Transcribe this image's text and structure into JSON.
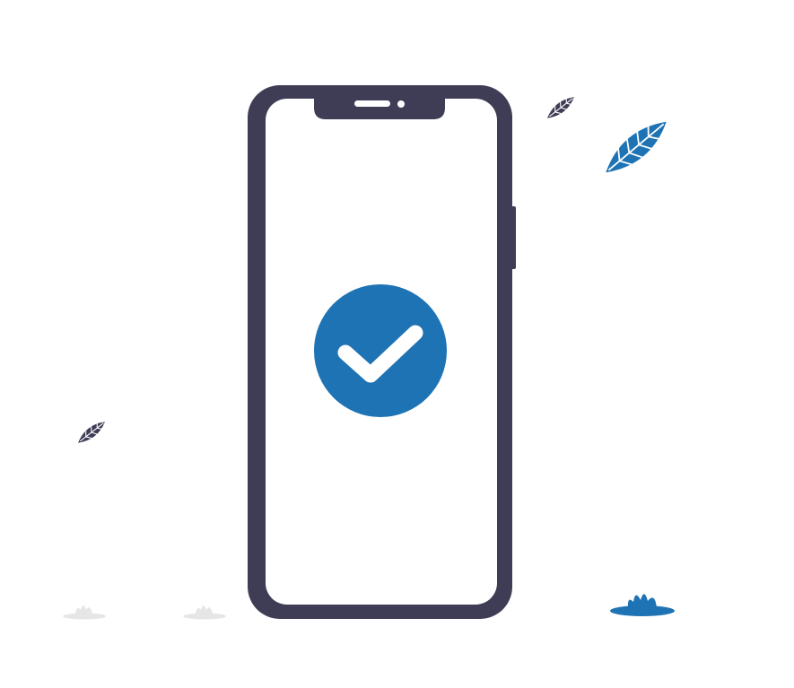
{
  "illustration": {
    "subject": "phone-with-success-checkmark",
    "icon": "check-circle-icon",
    "colors": {
      "phone_frame": "#3f3d56",
      "screen": "#ffffff",
      "accent": "#1e73b4",
      "checkmark": "#ffffff",
      "grass_light": "#e6e6e6",
      "leaf_dark": "#3f3d56",
      "leaf_blue": "#1e73b4"
    }
  }
}
